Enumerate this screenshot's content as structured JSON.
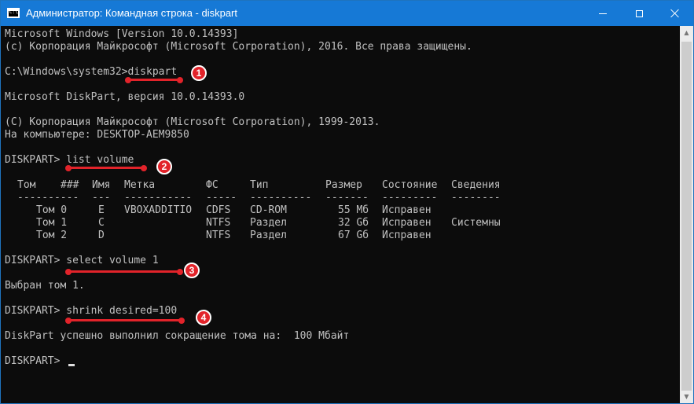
{
  "window": {
    "title": "Администратор: Командная строка - diskpart",
    "icon": "cmd-icon",
    "accent": "#1679d6"
  },
  "console": {
    "lines": [
      "Microsoft Windows [Version 10.0.14393]",
      "(c) Корпорация Майкрософт (Microsoft Corporation), 2016. Все права защищены.",
      "",
      "C:\\Windows\\system32>diskpart",
      "",
      "Microsoft DiskPart, версия 10.0.14393.0",
      "",
      "(C) Корпорация Майкрософт (Microsoft Corporation), 1999-2013.",
      "На компьютере: DESKTOP-AEM9850",
      "",
      "DISKPART> list volume"
    ],
    "table": {
      "headers": [
        "Том",
        "###",
        "Имя",
        "Метка",
        "ФС",
        "Тип",
        "Размер",
        "Состояние",
        "Сведения"
      ],
      "separators": [
        "----------",
        "---",
        "-----------",
        "-----",
        "----------",
        "-------",
        "---------",
        "--------"
      ],
      "rows": [
        [
          "Том 0",
          "E",
          "VBOXADDITIO",
          "CDFS",
          "CD-ROM",
          "55 Mб",
          "Исправен",
          ""
        ],
        [
          "Том 1",
          "C",
          "",
          "NTFS",
          "Раздел",
          "32 Gб",
          "Исправен",
          "Системны"
        ],
        [
          "Том 2",
          "D",
          "",
          "NTFS",
          "Раздел",
          "67 Gб",
          "Исправен",
          ""
        ]
      ]
    },
    "after_table": [
      "DISKPART> select volume 1",
      "",
      "Выбран том 1.",
      "",
      "DISKPART> shrink desired=100",
      "",
      "DiskPart успешно выполнил сокращение тома на:  100 Мбайт",
      "",
      "DISKPART> "
    ]
  },
  "annotations": {
    "color": "#e2232a",
    "badges": [
      "1",
      "2",
      "3",
      "4"
    ]
  }
}
